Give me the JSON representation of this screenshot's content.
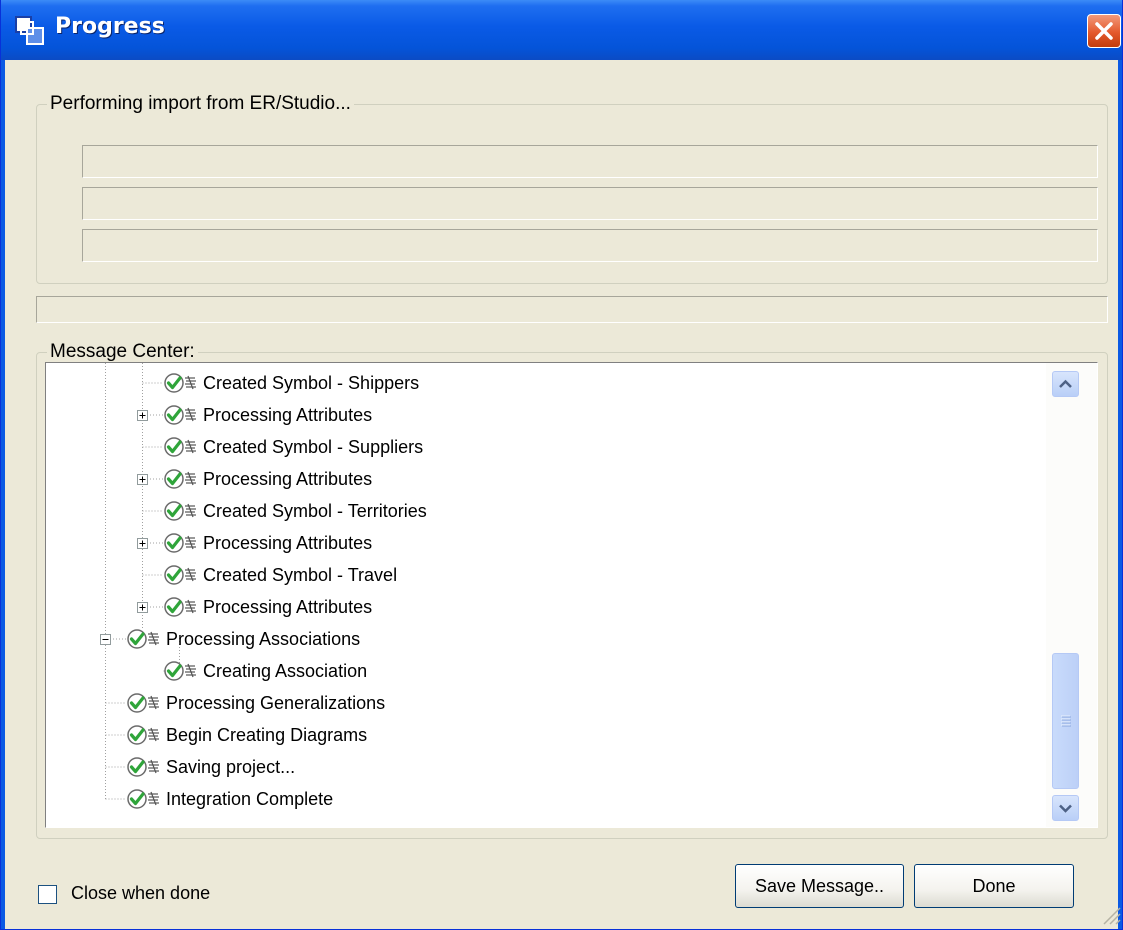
{
  "window": {
    "title": "Progress",
    "app_icon": "app-windows-icon",
    "close_icon": "close-icon"
  },
  "import_group": {
    "legend": "Performing import from ER/Studio...",
    "progress_bars": [
      0,
      0,
      0
    ]
  },
  "overall_progress": 0,
  "message_center": {
    "legend": "Message Center:",
    "items": [
      {
        "label": "Created Symbol - Shippers",
        "level": 3,
        "status_icon": "check-icon",
        "expander": "none"
      },
      {
        "label": "Processing Attributes",
        "level": 3,
        "status_icon": "check-icon",
        "expander": "collapsed"
      },
      {
        "label": "Created Symbol - Suppliers",
        "level": 3,
        "status_icon": "check-icon",
        "expander": "none"
      },
      {
        "label": "Processing Attributes",
        "level": 3,
        "status_icon": "check-icon",
        "expander": "collapsed"
      },
      {
        "label": "Created Symbol - Territories",
        "level": 3,
        "status_icon": "check-icon",
        "expander": "none"
      },
      {
        "label": "Processing Attributes",
        "level": 3,
        "status_icon": "check-icon",
        "expander": "collapsed"
      },
      {
        "label": "Created Symbol - Travel",
        "level": 3,
        "status_icon": "check-icon",
        "expander": "none"
      },
      {
        "label": "Processing Attributes",
        "level": 3,
        "status_icon": "check-icon",
        "expander": "collapsed"
      },
      {
        "label": "Processing Associations",
        "level": 2,
        "status_icon": "check-icon",
        "expander": "expanded"
      },
      {
        "label": "Creating Association",
        "level": 3,
        "status_icon": "check-icon",
        "expander": "none"
      },
      {
        "label": "Processing Generalizations",
        "level": 2,
        "status_icon": "check-icon",
        "expander": "none"
      },
      {
        "label": "Begin Creating Diagrams",
        "level": 2,
        "status_icon": "check-icon",
        "expander": "none"
      },
      {
        "label": "Saving project...",
        "level": 2,
        "status_icon": "check-icon",
        "expander": "none"
      },
      {
        "label": "Integration Complete",
        "level": 2,
        "status_icon": "check-icon",
        "expander": "none"
      }
    ]
  },
  "close_when_done": {
    "label": "Close when done",
    "checked": false
  },
  "buttons": {
    "save_message": "Save Message..",
    "done": "Done"
  },
  "colors": {
    "title_bar": "#0a5ae6",
    "dialog_bg": "#ece9d8",
    "check": "#2fa53a",
    "close_button": "#e4592c"
  }
}
